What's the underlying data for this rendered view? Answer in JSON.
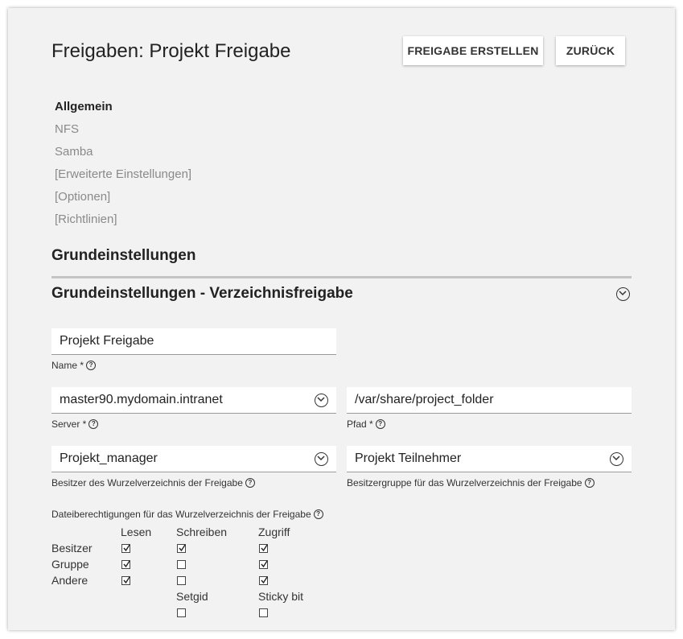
{
  "header": {
    "title": "Freigaben: Projekt Freigabe",
    "create_label": "FREIGABE ERSTELLEN",
    "back_label": "ZURÜCK"
  },
  "nav": {
    "items": [
      "Allgemein",
      "NFS",
      "Samba",
      "[Erweiterte Einstellungen]",
      "[Optionen]",
      "[Richtlinien]"
    ]
  },
  "section": {
    "title": "Grundeinstellungen",
    "subsection_title": "Grundeinstellungen - Verzeichnisfreigabe"
  },
  "form": {
    "name": {
      "value": "Projekt Freigabe",
      "label": "Name *"
    },
    "server": {
      "value": "master90.mydomain.intranet",
      "label": "Server *"
    },
    "path": {
      "value": "/var/share/project_folder",
      "label": "Pfad *"
    },
    "owner": {
      "value": "Projekt_manager",
      "label": "Besitzer des Wurzelverzeichnis der Freigabe"
    },
    "group": {
      "value": "Projekt Teilnehmer",
      "label": "Besitzergruppe für das Wurzelverzeichnis der Freigabe"
    }
  },
  "permissions": {
    "label": "Dateiberechtigungen für das Wurzelverzeichnis der Freigabe",
    "columns": [
      "Lesen",
      "Schreiben",
      "Zugriff"
    ],
    "rows": [
      {
        "name": "Besitzer",
        "checked": [
          true,
          true,
          true
        ]
      },
      {
        "name": "Gruppe",
        "checked": [
          true,
          false,
          true
        ]
      },
      {
        "name": "Andere",
        "checked": [
          true,
          false,
          true
        ]
      }
    ],
    "extra": [
      {
        "label": "Setgid",
        "checked": false
      },
      {
        "label": "Sticky bit",
        "checked": false
      }
    ]
  },
  "help_glyph": "?",
  "icons": {
    "expand": "chevron-down-circle-icon",
    "help": "question-circle-icon",
    "checkbox": "checkbox-check-icon"
  }
}
